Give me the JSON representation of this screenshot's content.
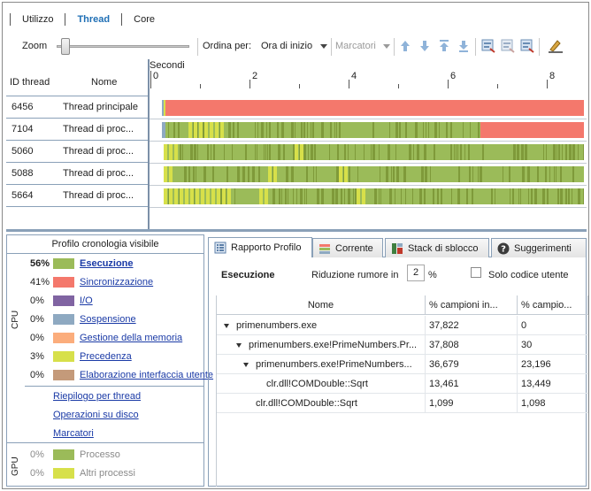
{
  "tabs": [
    {
      "label": "Utilizzo",
      "active": false
    },
    {
      "label": "Thread",
      "active": true
    },
    {
      "label": "Core",
      "active": false
    }
  ],
  "toolbar": {
    "zoom_label": "Zoom",
    "sort_label": "Ordina per:",
    "sort_value": "Ora di inizio",
    "markers_value": "Marcatori",
    "icons": [
      "move-up-icon",
      "move-down-icon",
      "move-top-icon",
      "move-bottom-icon",
      "export-icon",
      "export-alt-icon",
      "export-selected-icon",
      "highlight-icon"
    ]
  },
  "timeline": {
    "ruler_label": "Secondi",
    "ticks": [
      "0",
      "2",
      "4",
      "6",
      "8"
    ],
    "col_id": "ID thread",
    "col_name": "Nome",
    "rows": [
      {
        "id": "6456",
        "name": "Thread principale"
      },
      {
        "id": "7104",
        "name": "Thread di proc..."
      },
      {
        "id": "5060",
        "name": "Thread di proc..."
      },
      {
        "id": "5088",
        "name": "Thread di proc..."
      },
      {
        "id": "5664",
        "name": "Thread di proc..."
      }
    ]
  },
  "colors": {
    "execution": "#9bbb59",
    "sync": "#f4786c",
    "io": "#8064a2",
    "sleep": "#8ea9c1",
    "memory": "#fbad7c",
    "preemption": "#d7e04a",
    "ui": "#c49a7a",
    "accent": "#1f6fb5"
  },
  "profile": {
    "title": "Profilo cronologia visibile",
    "cpu_label": "CPU",
    "gpu_label": "GPU",
    "cpu_items": [
      {
        "pct": "56%",
        "label": "Esecuzione"
      },
      {
        "pct": "41%",
        "label": "Sincronizzazione"
      },
      {
        "pct": "0%",
        "label": "I/O"
      },
      {
        "pct": "0%",
        "label": "Sospensione"
      },
      {
        "pct": "0%",
        "label": "Gestione della memoria"
      },
      {
        "pct": "3%",
        "label": "Precedenza"
      },
      {
        "pct": "0%",
        "label": "Elaborazione interfaccia utente"
      }
    ],
    "links": [
      "Riepilogo per thread",
      "Operazioni su disco",
      "Marcatori"
    ],
    "gpu_items": [
      {
        "pct": "0%",
        "label": "Processo"
      },
      {
        "pct": "0%",
        "label": "Altri processi"
      }
    ]
  },
  "report": {
    "tabs": [
      {
        "label": "Rapporto Profilo",
        "icon": "report-icon"
      },
      {
        "label": "Corrente",
        "icon": "current-icon"
      },
      {
        "label": "Stack di sblocco",
        "icon": "unblock-stack-icon"
      },
      {
        "label": "Suggerimenti",
        "icon": "help-icon"
      }
    ],
    "section": "Esecuzione",
    "noise_label": "Riduzione rumore in",
    "noise_value": "2",
    "noise_unit": "%",
    "only_user_code": "Solo codice utente",
    "columns": [
      "Nome",
      "% campioni in...",
      "% campio..."
    ],
    "rows": [
      {
        "level": 0,
        "expand": true,
        "name": "primenumbers.exe",
        "a": "37,822",
        "b": "0"
      },
      {
        "level": 1,
        "expand": true,
        "name": "primenumbers.exe!PrimeNumbers.Pr...",
        "a": "37,808",
        "b": "30"
      },
      {
        "level": 2,
        "expand": true,
        "name": "primenumbers.exe!PrimeNumbers...",
        "a": "36,679",
        "b": "23,196"
      },
      {
        "level": 3,
        "expand": false,
        "name": "clr.dll!COMDouble::Sqrt",
        "a": "13,461",
        "b": "13,449"
      },
      {
        "level": 2,
        "expand": false,
        "name": "clr.dll!COMDouble::Sqrt",
        "a": "1,099",
        "b": "1,098"
      }
    ]
  }
}
